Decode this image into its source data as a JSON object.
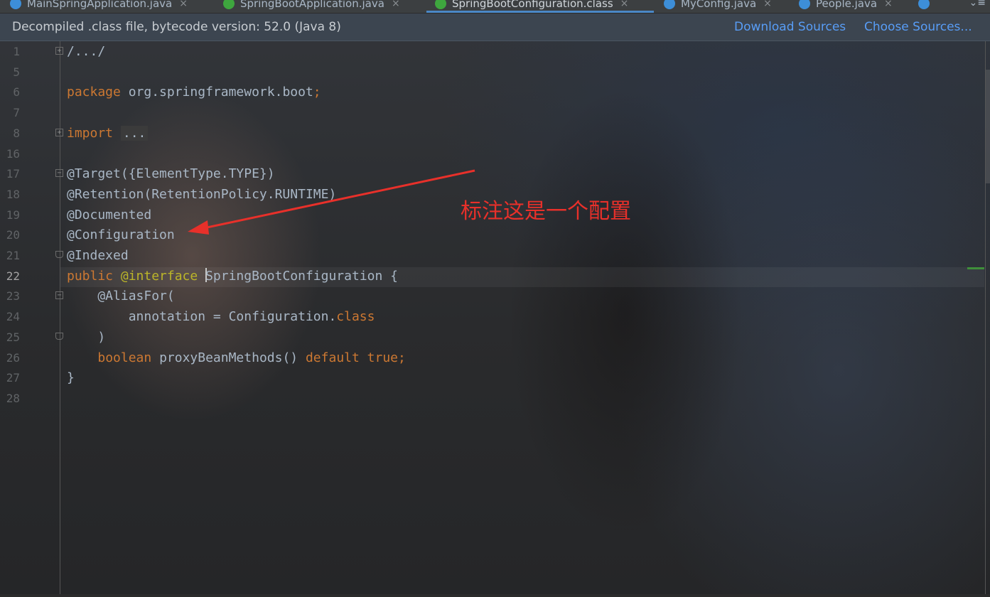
{
  "tabs": [
    {
      "label": "MainSpringApplication.java",
      "icon": "class-icon",
      "color": "#3d8ed8",
      "active": false
    },
    {
      "label": "SpringBootApplication.java",
      "icon": "annotation-icon",
      "color": "#3ea63e",
      "active": false
    },
    {
      "label": "SpringBootConfiguration.class",
      "icon": "annotation-class-icon",
      "color": "#3ea63e",
      "active": true
    },
    {
      "label": "MyConfig.java",
      "icon": "class-icon",
      "color": "#3d8ed8",
      "active": false
    },
    {
      "label": "People.java",
      "icon": "class-icon",
      "color": "#3d8ed8",
      "active": false
    }
  ],
  "tab_close_glyph": "×",
  "tab_overflow_glyph": "⌄≡",
  "notice": {
    "text": "Decompiled .class file, bytecode version: 52.0 (Java 8)",
    "download_sources": "Download Sources",
    "choose_sources": "Choose Sources..."
  },
  "editor": {
    "current_line": "22",
    "lines": [
      {
        "n": "1",
        "fold": "+",
        "parts": [
          [
            "t",
            "/.../"
          ]
        ]
      },
      {
        "n": "5",
        "fold": "",
        "parts": []
      },
      {
        "n": "6",
        "fold": "",
        "parts": [
          [
            "kw",
            "package "
          ],
          [
            "t",
            "org.springframework.boot"
          ],
          [
            "kw",
            ";"
          ]
        ]
      },
      {
        "n": "7",
        "fold": "",
        "parts": []
      },
      {
        "n": "8",
        "fold": "+",
        "parts": [
          [
            "kw",
            "import "
          ],
          [
            "f",
            "..."
          ]
        ]
      },
      {
        "n": "16",
        "fold": "",
        "parts": []
      },
      {
        "n": "17",
        "fold": "-",
        "parts": [
          [
            "t",
            "@Target({ElementType.TYPE})"
          ]
        ]
      },
      {
        "n": "18",
        "fold": "",
        "parts": [
          [
            "t",
            "@Retention(RetentionPolicy.RUNTIME)"
          ]
        ]
      },
      {
        "n": "19",
        "fold": "",
        "parts": [
          [
            "t",
            "@Documented"
          ]
        ]
      },
      {
        "n": "20",
        "fold": "",
        "parts": [
          [
            "t",
            "@Configuration"
          ]
        ]
      },
      {
        "n": "21",
        "fold": "-e",
        "parts": [
          [
            "t",
            "@Indexed"
          ]
        ]
      },
      {
        "n": "22",
        "fold": "",
        "parts": [
          [
            "kw",
            "public "
          ],
          [
            "ann",
            "@interface "
          ],
          [
            "c",
            ""
          ],
          [
            "t",
            "SpringBootConfiguration {"
          ]
        ]
      },
      {
        "n": "23",
        "fold": "-",
        "parts": [
          [
            "t",
            "    @AliasFor("
          ]
        ]
      },
      {
        "n": "24",
        "fold": "",
        "parts": [
          [
            "t",
            "        annotation = Configuration."
          ],
          [
            "kw",
            "class"
          ]
        ]
      },
      {
        "n": "25",
        "fold": "-e",
        "parts": [
          [
            "t",
            "    )"
          ]
        ]
      },
      {
        "n": "26",
        "fold": "",
        "parts": [
          [
            "t",
            "    "
          ],
          [
            "kw",
            "boolean "
          ],
          [
            "t",
            "proxyBeanMethods() "
          ],
          [
            "kw",
            "default true;"
          ]
        ]
      },
      {
        "n": "27",
        "fold": "",
        "parts": [
          [
            "t",
            "}"
          ]
        ]
      },
      {
        "n": "28",
        "fold": "",
        "parts": []
      }
    ]
  },
  "annotation_overlay": {
    "text": "标注这是一个配置",
    "color": "#e8302a"
  }
}
